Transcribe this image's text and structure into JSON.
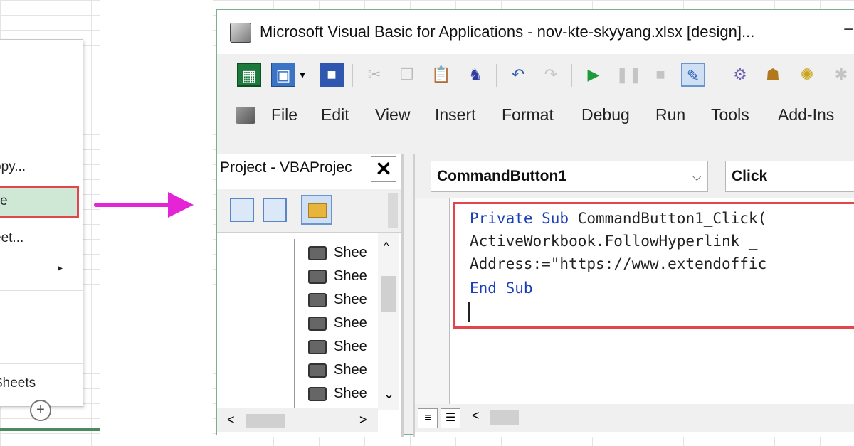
{
  "context_menu": {
    "items": [
      {
        "label": "opy..."
      },
      {
        "label": "e"
      },
      {
        "label": "eet..."
      },
      {
        "label": "Sheets"
      }
    ],
    "submenu_arrow": "▸",
    "add_symbol": "+"
  },
  "vba": {
    "title": "Microsoft Visual Basic for Applications - nov-kte-skyyang.xlsx [design]...",
    "minimize_symbol": "−",
    "toolbar_icons": [
      "excel-icon",
      "insert-userform-icon",
      "save-icon",
      "cut-icon",
      "copy-icon",
      "paste-icon",
      "find-icon",
      "undo-icon",
      "redo-icon",
      "run-icon",
      "break-icon",
      "reset-icon",
      "design-mode-icon",
      "project-explorer-icon",
      "properties-icon",
      "object-browser-icon"
    ],
    "menu": [
      "File",
      "Edit",
      "View",
      "Insert",
      "Format",
      "Debug",
      "Run",
      "Tools",
      "Add-Ins"
    ],
    "project_panel": {
      "title": "Project - VBAProjec",
      "close_symbol": "✕",
      "sheets": [
        "Shee",
        "Shee",
        "Shee",
        "Shee",
        "Shee",
        "Shee",
        "Shee"
      ]
    },
    "code": {
      "object_combo": "CommandButton1",
      "procedure_combo": "Click",
      "combo_chevron": "⌵",
      "lines": [
        {
          "kw1": "Private Sub",
          "rest": " CommandButton1_Click("
        },
        {
          "kw1": "",
          "rest": "ActiveWorkbook.FollowHyperlink _"
        },
        {
          "kw1": "",
          "rest": "Address:=\"https://www.extendoffic"
        },
        {
          "kw1": "End Sub",
          "rest": ""
        }
      ]
    },
    "scroll_left": "<",
    "scroll_right": ">",
    "scroll_up": "^",
    "scroll_down": "⌄"
  },
  "colors": {
    "highlight_red": "#e0474c",
    "arrow_magenta": "#e524d6",
    "keyword_blue": "#1a3fb8",
    "window_border_green": "#7bb08e"
  }
}
